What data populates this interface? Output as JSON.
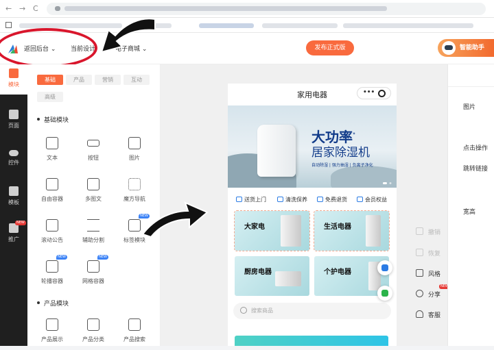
{
  "browser": {
    "nav_back": "←",
    "nav_forward": "→",
    "nav_reload": "C",
    "site_icon": "site-settings-icon",
    "apps_icon": "apps-grid-icon"
  },
  "topbar": {
    "back_label": "返回后台",
    "design_label": "当前设计",
    "store_label": "电子商城",
    "publish_label": "发布正式版",
    "assistant_label": "智能助手",
    "colors": {
      "accent": "#f96a3e",
      "annotation_red": "#d9162c"
    }
  },
  "rail": {
    "items": [
      {
        "label": "模块",
        "icon": "module-icon"
      },
      {
        "label": "页面",
        "icon": "page-icon"
      },
      {
        "label": "控件",
        "icon": "toggle-icon"
      },
      {
        "label": "模板",
        "icon": "template-icon"
      },
      {
        "label": "推广",
        "icon": "megaphone-icon",
        "badge": "NEW"
      }
    ]
  },
  "panel": {
    "chips": [
      "基础",
      "产品",
      "营销",
      "互动",
      "高级"
    ],
    "basic_title": "基础模块",
    "basic_modules": [
      {
        "label": "文本",
        "icon": "text-icon"
      },
      {
        "label": "按钮",
        "icon": "button-icon"
      },
      {
        "label": "图片",
        "icon": "image-icon"
      },
      {
        "label": "自由容器",
        "icon": "free-container-icon"
      },
      {
        "label": "多图文",
        "icon": "multi-image-icon"
      },
      {
        "label": "魔方导航",
        "icon": "cube-nav-icon"
      },
      {
        "label": "滚动公告",
        "icon": "notice-icon"
      },
      {
        "label": "辅助分割",
        "icon": "divider-icon"
      },
      {
        "label": "标签模块",
        "icon": "tab-module-icon",
        "badge": "NEW"
      },
      {
        "label": "轮播容器",
        "icon": "carousel-icon",
        "badge": "NEW"
      },
      {
        "label": "网格容器",
        "icon": "grid-container-icon",
        "badge": "NEW"
      }
    ],
    "product_title": "产品模块",
    "product_modules": [
      {
        "label": "产品展示",
        "icon": "product-display-icon"
      },
      {
        "label": "产品分类",
        "icon": "product-category-icon"
      },
      {
        "label": "产品搜索",
        "icon": "product-search-icon"
      }
    ]
  },
  "phone": {
    "title": "家用电器",
    "capsule_dots": "•••",
    "banner": {
      "headline": "大功率",
      "headline_mark": "°",
      "subline": "居家除湿机",
      "tagline": "自动除湿 | 强力抽湿 | 负离子净化"
    },
    "services": [
      "送货上门",
      "清洗保养",
      "免费退货",
      "会员权益"
    ],
    "categories": [
      "大家电",
      "生活电器",
      "厨房电器",
      "个护电器"
    ],
    "search_placeholder": "搜索商品"
  },
  "tools": [
    {
      "label": "撤销",
      "icon": "undo-icon",
      "enabled": false
    },
    {
      "label": "恢复",
      "icon": "redo-icon",
      "enabled": false
    },
    {
      "label": "风格",
      "icon": "shirt-icon",
      "enabled": true
    },
    {
      "label": "分享",
      "icon": "share-icon",
      "enabled": true,
      "badge": "NEW"
    },
    {
      "label": "客服",
      "icon": "headset-icon",
      "enabled": true
    }
  ],
  "props": {
    "items": [
      "图片",
      "点击操作",
      "跳转链接",
      "宽高"
    ]
  }
}
